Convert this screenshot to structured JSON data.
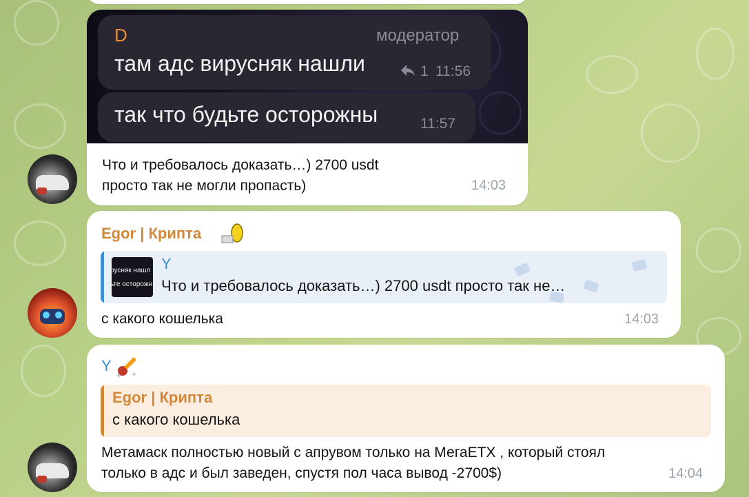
{
  "msg1": {
    "image": {
      "sender": "D",
      "role": "модератор",
      "line1": "там адс вирусняк нашли",
      "reply_icon": "reply-arrow-icon",
      "reply_count": "1",
      "time1": "11:56",
      "line2": "так что будьте осторожны",
      "time2": "11:57"
    },
    "text_line1": "Что и требовалось доказать…) 2700 usdt",
    "text_line2": "просто так не могли пропасть)",
    "time": "14:03"
  },
  "msg2": {
    "sender": "Egor | Крипта",
    "sender_color": "#d0883a",
    "quote": {
      "author": "Y",
      "thumb_line1": "русняк нашл",
      "thumb_line2": "ьте осторожн",
      "text": "Что и требовалось доказать…) 2700 usdt просто так не…"
    },
    "text": "с какого кошелька",
    "time": "14:03"
  },
  "msg3": {
    "sender": "Y",
    "sender_color": "#3d8fd1",
    "quote": {
      "author": "Egor | Крипта",
      "text": "с какого кошелька"
    },
    "text_line1": "Метамаск полностью новый с апрувом только на МегаETX , который стоял",
    "text_line2": "только в адс и был заведен, спустя пол часа вывод -2700$)",
    "time": "14:04"
  }
}
